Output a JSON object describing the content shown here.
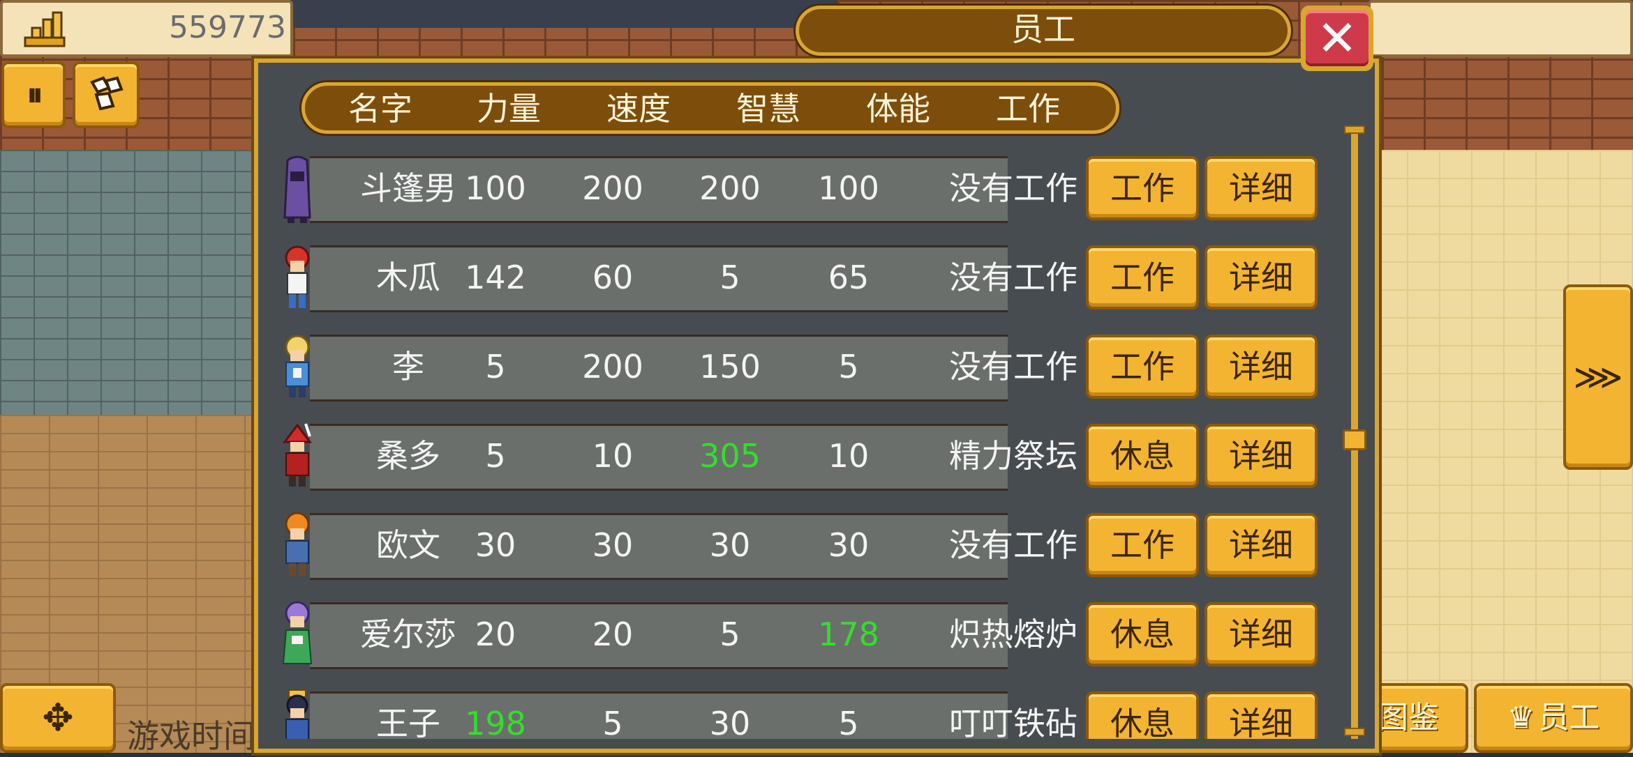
{
  "hud": {
    "money": "559773",
    "pause_label": "⏸",
    "game_time_label": "游戏时间",
    "codex_label": "图鉴",
    "staff_label": "员工",
    "staff_icon": "♛",
    "move_icon": "✥",
    "next_icon": "⋙"
  },
  "dialog": {
    "title": "员工",
    "close_icon": "✕",
    "columns": [
      "名字",
      "力量",
      "速度",
      "智慧",
      "体能",
      "工作"
    ]
  },
  "staff": [
    {
      "name": "斗篷男",
      "strength": "100",
      "speed": "200",
      "wisdom": "200",
      "stamina": "100",
      "job": "没有工作",
      "action": "工作",
      "detail": "详细",
      "highlight": ""
    },
    {
      "name": "木瓜",
      "strength": "142",
      "speed": "60",
      "wisdom": "5",
      "stamina": "65",
      "job": "没有工作",
      "action": "工作",
      "detail": "详细",
      "highlight": ""
    },
    {
      "name": "李",
      "strength": "5",
      "speed": "200",
      "wisdom": "150",
      "stamina": "5",
      "job": "没有工作",
      "action": "工作",
      "detail": "详细",
      "highlight": ""
    },
    {
      "name": "桑多",
      "strength": "5",
      "speed": "10",
      "wisdom": "305",
      "stamina": "10",
      "job": "精力祭坛",
      "action": "休息",
      "detail": "详细",
      "highlight": "wisdom"
    },
    {
      "name": "欧文",
      "strength": "30",
      "speed": "30",
      "wisdom": "30",
      "stamina": "30",
      "job": "没有工作",
      "action": "工作",
      "detail": "详细",
      "highlight": ""
    },
    {
      "name": "爱尔莎",
      "strength": "20",
      "speed": "20",
      "wisdom": "5",
      "stamina": "178",
      "job": "炽热熔炉",
      "action": "休息",
      "detail": "详细",
      "highlight": "stamina"
    },
    {
      "name": "王子",
      "strength": "198",
      "speed": "5",
      "wisdom": "30",
      "stamina": "5",
      "job": "叮叮铁砧",
      "action": "休息",
      "detail": "详细",
      "highlight": "strength"
    }
  ],
  "colors": {
    "gold": "#f2b431",
    "panel": "#474c51",
    "highlight_green": "#35dd2d",
    "close_red": "#cf3a4b"
  }
}
